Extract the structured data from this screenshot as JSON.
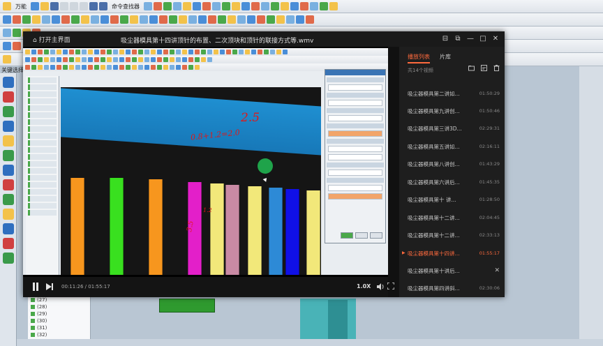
{
  "cad": {
    "toolbar_labels": [
      "万能",
      "命令查找器"
    ],
    "nav_label": "关键选择",
    "tree_items": [
      "(27)",
      "(28)",
      "(29)",
      "(30)",
      "(31)",
      "(32)"
    ]
  },
  "player": {
    "back_label": "打开主界面",
    "title": "吸尘器模具第十四讲顶针的布置、二次顶块和顶针的联接方式等.wmv",
    "controls": {
      "time": "00:11:26 / 01:55:17",
      "speed": "1.0X"
    },
    "window_controls": {
      "pin": "⊟",
      "share": "⧉",
      "minimize": "—",
      "maximize": "□",
      "close": "✕"
    }
  },
  "video_content": {
    "handwriting": [
      "2.5",
      "0.8+1.2=2.0",
      "1.2",
      "3.5"
    ]
  },
  "playlist": {
    "tabs": [
      "播放列表",
      "片库"
    ],
    "count_label": "共14个视频",
    "items": [
      {
        "name": "吸尘器模具第二讲如...",
        "duration": "01:50:29"
      },
      {
        "name": "吸尘器模具第九讲创...",
        "duration": "01:50:46"
      },
      {
        "name": "吸尘器模具第三讲3D...",
        "duration": "02:29:31"
      },
      {
        "name": "吸尘器模具第五讲如...",
        "duration": "02:16:11"
      },
      {
        "name": "吸尘器模具第八讲创...",
        "duration": "01:43:29"
      },
      {
        "name": "吸尘器模具第六讲后...",
        "duration": "01:45:35"
      },
      {
        "name": "吸尘器模具第十 讲...",
        "duration": "01:28:50"
      },
      {
        "name": "吸尘器模具第十二讲...",
        "duration": "02:04:45"
      },
      {
        "name": "吸尘器模具第十二讲...",
        "duration": "02:33:13"
      },
      {
        "name": "吸尘器模具第十四讲...",
        "duration": "01:55:17"
      },
      {
        "name": "吸尘器模具第十讲后...",
        "duration": ""
      },
      {
        "name": "吸尘器模具第四讲斜...",
        "duration": "02:30:06"
      }
    ]
  },
  "colors": {
    "accent": "#ff6a3d",
    "pillars": [
      "#f7961e",
      "#39e01f",
      "#f7961e",
      "#e31fc9",
      "#f2e87a",
      "#c98aa4",
      "#f2e87a",
      "#2d8ad6",
      "#1010e6",
      "#f2e87a",
      "#8a3fd6",
      "#f2e87a",
      "#f7961e"
    ]
  }
}
